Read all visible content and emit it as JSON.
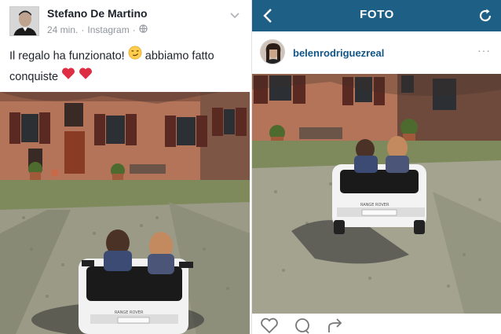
{
  "facebook_post": {
    "author": "Stefano De Martino",
    "time": "24 min.",
    "separator": "·",
    "source": "Instagram",
    "text_line1": "Il regalo ha funzionato!",
    "text_line1_end": "abbiamo fatto",
    "text_line2": "conquiste",
    "icons": [
      "chevron-down-icon",
      "globe-icon",
      "smirk-emoji-icon",
      "heart-emoji-icon"
    ]
  },
  "instagram": {
    "title": "FOTO",
    "username": "belenrodriguezreal",
    "more": "···",
    "icons": [
      "back-arrow-icon",
      "refresh-icon",
      "like-icon",
      "comment-icon",
      "share-icon"
    ],
    "accent_color": "#1e5f86",
    "username_color": "#125688"
  },
  "photo_car": {
    "plate_text": "RANGE ROVER"
  }
}
